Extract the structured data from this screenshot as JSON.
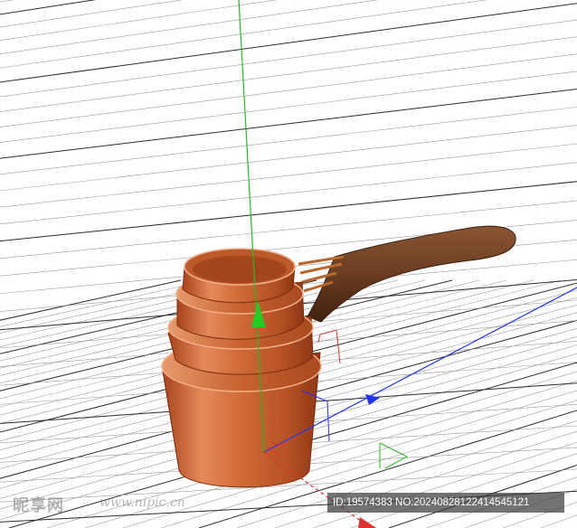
{
  "viewport": {
    "background": "#ffffff",
    "grid_color": "#9a9a9a",
    "grid_major_color": "#2b2b2b",
    "axis_colors": {
      "x": "#2233ee",
      "y": "#22bb22",
      "z": "#e03030"
    },
    "object": "copper measuring cups with wooden handle",
    "icons": [
      "y-arrow-icon",
      "x-arrow-icon",
      "rotate-gizmo-icon",
      "scale-gizmo-icon"
    ]
  },
  "watermark": {
    "brand": "昵享网",
    "url": "www.nipic.cn"
  },
  "image_id": {
    "text": "ID:19574383 NO:20240828122414545121"
  },
  "colors": {
    "copper": "#c8622f",
    "wood": "#6b3d22"
  }
}
